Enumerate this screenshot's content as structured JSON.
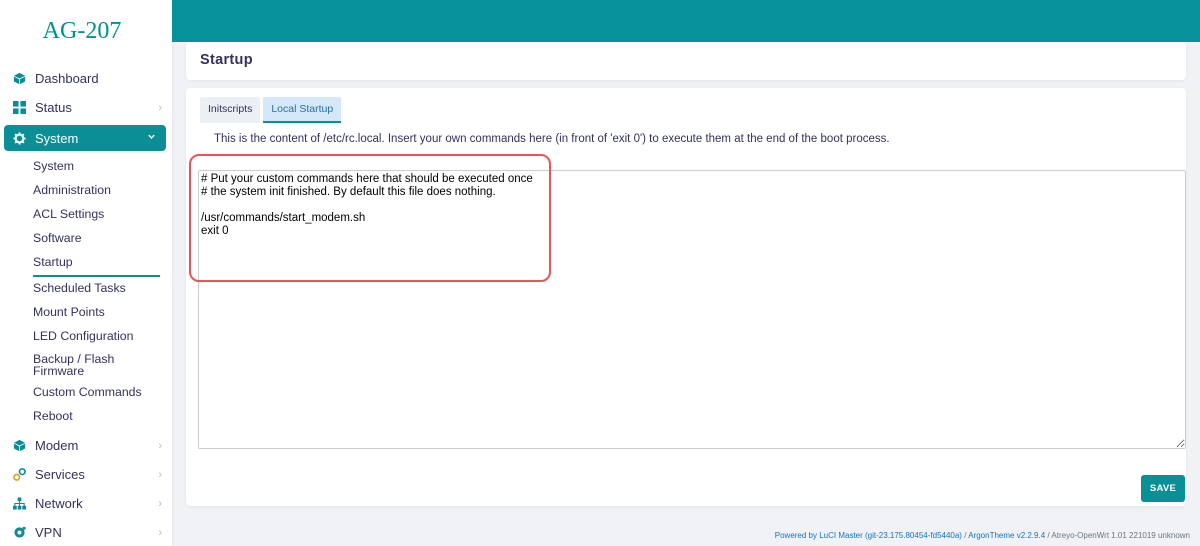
{
  "brand": "AG-207",
  "sidebar": {
    "top_items": [
      {
        "label": "Dashboard",
        "icon": "cube-icon"
      },
      {
        "label": "Status",
        "icon": "grid-icon"
      },
      {
        "label": "System",
        "icon": "gear-icon"
      },
      {
        "label": "Modem",
        "icon": "cube-icon"
      },
      {
        "label": "Services",
        "icon": "services-icon"
      },
      {
        "label": "Network",
        "icon": "network-icon"
      },
      {
        "label": "VPN",
        "icon": "vpn-icon"
      }
    ],
    "chevron_right": "›",
    "chevron_down": "⌄",
    "system_sub": [
      "System",
      "Administration",
      "ACL Settings",
      "Software",
      "Startup",
      "Scheduled Tasks",
      "Mount Points",
      "LED Configuration",
      "Backup / Flash Firmware",
      "Custom Commands",
      "Reboot"
    ]
  },
  "page": {
    "title": "Startup",
    "tabs": [
      "Initscripts",
      "Local Startup"
    ],
    "active_tab": "Local Startup",
    "description": "This is the content of /etc/rc.local. Insert your own commands here (in front of 'exit 0') to execute them at the end of the boot process.",
    "editor_content": "# Put your custom commands here that should be executed once\n# the system init finished. By default this file does nothing.\n\n/usr/commands/start_modem.sh\nexit 0",
    "save_label": "SAVE"
  },
  "footer": {
    "luci": "Powered by LuCI Master (git-23.175.80454-fd5440a)",
    "sep1": " / ",
    "theme": "ArgonTheme v2.2.9.4",
    "sep2": " / ",
    "version": "Atreyo-OpenWrt 1.01 221019 unknown"
  },
  "colors": {
    "accent": "#0a8f96",
    "topbar": "#07919a",
    "highlight": "#e8545a"
  }
}
